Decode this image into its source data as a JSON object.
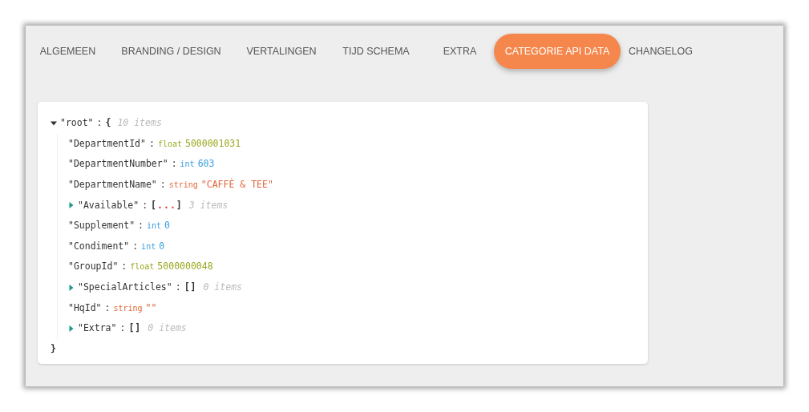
{
  "tabs": [
    {
      "label": "ALGEMEEN",
      "selected": false
    },
    {
      "label": "BRANDING / DESIGN",
      "selected": false
    },
    {
      "label": "VERTALINGEN",
      "selected": false
    },
    {
      "label": "TIJD SCHEMA",
      "selected": false
    },
    {
      "label": "EXTRA",
      "selected": false
    },
    {
      "label": "CATEGORIE API DATA",
      "selected": true
    },
    {
      "label": "CHANGELOG",
      "selected": false
    }
  ],
  "json_viewer": {
    "root": {
      "key": "\"root\"",
      "separator": ":",
      "bracket": "{",
      "count": "10 items",
      "expanded": true,
      "close": "}",
      "items": [
        {
          "kind": "value",
          "key": "\"DepartmentId\"",
          "separator": ":",
          "type": "float",
          "value": "5000001031"
        },
        {
          "kind": "value",
          "key": "\"DepartmentNumber\"",
          "separator": ":",
          "type": "int",
          "value": "603"
        },
        {
          "kind": "value",
          "key": "\"DepartmentName\"",
          "separator": ":",
          "type": "string",
          "value": "\"CAFFÈ & TEE\""
        },
        {
          "kind": "collection",
          "key": "\"Available\"",
          "separator": ":",
          "expanded": false,
          "bracket": "[",
          "ellipsis": "...",
          "close": "]",
          "count": "3 items"
        },
        {
          "kind": "value",
          "key": "\"Supplement\"",
          "separator": ":",
          "type": "int",
          "value": "0"
        },
        {
          "kind": "value",
          "key": "\"Condiment\"",
          "separator": ":",
          "type": "int",
          "value": "0"
        },
        {
          "kind": "value",
          "key": "\"GroupId\"",
          "separator": ":",
          "type": "float",
          "value": "5000000048"
        },
        {
          "kind": "collection",
          "key": "\"SpecialArticles\"",
          "separator": ":",
          "expanded": false,
          "bracket": "[",
          "close": "]",
          "count": "0 items"
        },
        {
          "kind": "value",
          "key": "\"HqId\"",
          "separator": ":",
          "type": "string",
          "value": "\"\""
        },
        {
          "kind": "collection",
          "key": "\"Extra\"",
          "separator": ":",
          "expanded": false,
          "bracket": "[",
          "close": "]",
          "count": "0 items"
        }
      ]
    }
  }
}
